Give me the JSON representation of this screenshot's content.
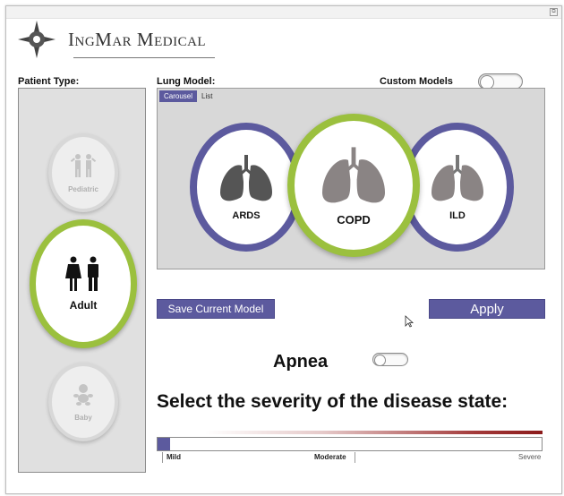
{
  "logo": {
    "text": "IngMar Medical"
  },
  "labels": {
    "patient_type": "Patient Type:",
    "lung_model": "Lung Model:",
    "custom_models": "Custom Models"
  },
  "patient_types": [
    {
      "label": "Pediatric",
      "selected": false
    },
    {
      "label": "Adult",
      "selected": true
    },
    {
      "label": "Baby",
      "selected": false
    }
  ],
  "view_tabs": [
    {
      "label": "Carousel",
      "active": true
    },
    {
      "label": "List",
      "active": false
    }
  ],
  "lung_models": [
    {
      "label": "ARDS",
      "selected": false
    },
    {
      "label": "COPD",
      "selected": true
    },
    {
      "label": "ILD",
      "selected": false
    }
  ],
  "buttons": {
    "save": "Save Current Model",
    "apply": "Apply"
  },
  "apnea": {
    "label": "Apnea",
    "enabled": false
  },
  "custom_models_enabled": false,
  "severity": {
    "title": "Select the severity of the disease state:",
    "mild": "Mild",
    "moderate": "Moderate",
    "severe": "Severe",
    "value": 0
  },
  "colors": {
    "accent_purple": "#5c5a9e",
    "accent_green": "#9bc03e",
    "severity_red": "#8b1a1a"
  }
}
